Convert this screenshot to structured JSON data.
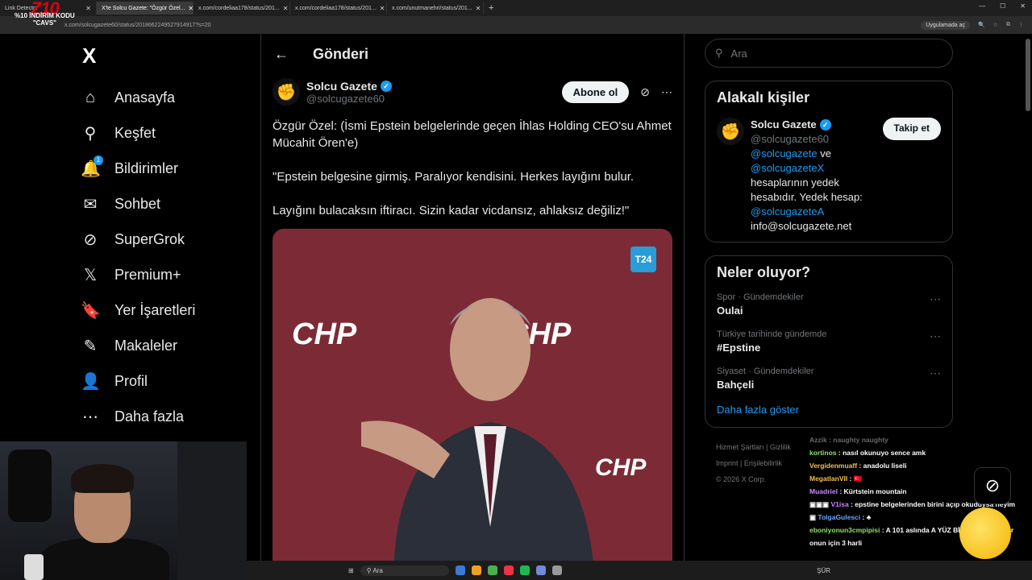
{
  "browser": {
    "tabs": [
      {
        "title": "Link Detector"
      },
      {
        "title": "X'te Solcu Gazete: \"Özgür Özel...",
        "active": true
      },
      {
        "title": "x.com/cordeliaa178/status/201..."
      },
      {
        "title": "x.com/cordeliaa178/status/201..."
      },
      {
        "title": "x.com/unutmanehri/status/201..."
      }
    ],
    "url": "x.com/solcugazete60/status/2018662249527914917?s=20",
    "app_pill": "Uygulamada aç"
  },
  "overlay": {
    "logo_text": "Z10",
    "promo_line1": "%10 İNDİRİM KODU",
    "promo_line2": "\"CAVS\""
  },
  "sidebar": {
    "logo": "X",
    "items": [
      {
        "label": "Anasayfa",
        "icon": "home-icon",
        "glyph": "⌂"
      },
      {
        "label": "Keşfet",
        "icon": "search-icon",
        "glyph": "⚲"
      },
      {
        "label": "Bildirimler",
        "icon": "bell-icon",
        "glyph": "🔔",
        "badge": "1"
      },
      {
        "label": "Sohbet",
        "icon": "mail-icon",
        "glyph": "✉"
      },
      {
        "label": "SuperGrok",
        "icon": "grok-icon",
        "glyph": "⊘"
      },
      {
        "label": "Premium+",
        "icon": "x-icon",
        "glyph": "𝕏"
      },
      {
        "label": "Yer İşaretleri",
        "icon": "bookmark-icon",
        "glyph": "🔖"
      },
      {
        "label": "Makaleler",
        "icon": "article-icon",
        "glyph": "✎"
      },
      {
        "label": "Profil",
        "icon": "profile-icon",
        "glyph": "👤"
      },
      {
        "label": "Daha fazla",
        "icon": "more-icon",
        "glyph": "⋯"
      }
    ]
  },
  "main": {
    "header_title": "Gönderi",
    "post": {
      "author_name": "Solcu Gazete",
      "author_handle": "@solcugazete60",
      "follow_label": "Abone ol",
      "text_1": "Özgür Özel: (İsmi Epstein belgelerinde geçen İhlas Holding CEO'su Ahmet Mücahit Ören'e)",
      "text_2": "\"Epstein belgesine girmiş. Paralıyor kendisini. Herkes layığını bulur.",
      "text_3": "Layığını bulacaksın iftiracı. Sizin kadar vicdansız, ahlaksız değiliz!\"",
      "media_badge": "T24",
      "media_logo": "CHP"
    }
  },
  "right": {
    "search_placeholder": "Ara",
    "related": {
      "title": "Alakalı kişiler",
      "name": "Solcu Gazete",
      "handle": "@solcugazete60",
      "button": "Takip et",
      "bio_link1": "@solcugazete",
      "bio_and": " ve ",
      "bio_link2": "@solcugazeteX",
      "bio_mid": "hesaplarının yedek hesabıdır. Yedek hesap: ",
      "bio_link3": "@solcugazeteA",
      "bio_email": "info@solcugazete.net"
    },
    "trends": {
      "title": "Neler oluyor?",
      "items": [
        {
          "category": "Spor · Gündemdekiler",
          "topic": "Oulai"
        },
        {
          "category": "Türkiye tarihinde gündemde",
          "topic": "#Epstine"
        },
        {
          "category": "Siyaset · Gündemdekiler",
          "topic": "Bahçeli"
        }
      ],
      "show_more": "Daha fazla göster"
    },
    "footer": {
      "line1": "Hizmet Şartları   |   Gizlilik",
      "line2": "Imprint   |   Erişilebilirlik",
      "line3": "© 2026 X Corp."
    }
  },
  "chat": {
    "messages": [
      {
        "user": "Azzik",
        "text": "naughty naughty",
        "faded": true
      },
      {
        "user": "kortinos",
        "text": "nasıl okunuyo sence amk"
      },
      {
        "user": "Vergidenmuaff",
        "text": "anadolu liseli"
      },
      {
        "user": "MegatlanVII",
        "text": ""
      },
      {
        "user": "Muadriel",
        "text": "Kürtstein mountain"
      },
      {
        "user": "V1isa",
        "text": "epstine belgelerinden birini açıp okuduysa neyim"
      },
      {
        "user": "TolgaGulesci",
        "text": ""
      },
      {
        "user": "eboniyonun3cmpipisi",
        "text": "A 101 aslında A YÜZ BİR diye okunuyor onun için 3 harli"
      }
    ]
  },
  "taskbar": {
    "search_placeholder": "Ara",
    "right_text": "ŞÜR"
  }
}
